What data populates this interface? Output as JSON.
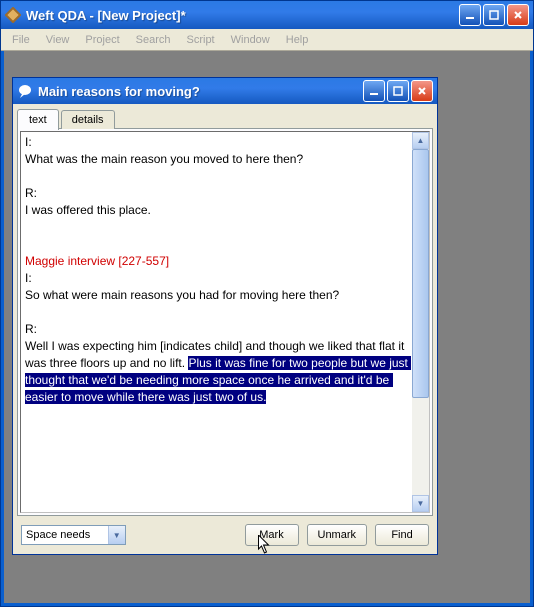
{
  "outer": {
    "title": "Weft QDA - [New Project]*",
    "menu": [
      "File",
      "View",
      "Project",
      "Search",
      "Script",
      "Window",
      "Help"
    ]
  },
  "child": {
    "title": "Main reasons for moving?",
    "tabs": [
      {
        "label": "text",
        "active": true
      },
      {
        "label": "details",
        "active": false
      }
    ],
    "text": {
      "line1": "I:",
      "line2": "What was the main reason you moved to here then?",
      "line3": "",
      "line4": "R:",
      "line5": "I was offered this place.",
      "line6": "",
      "line7": "",
      "ref": "Maggie interview [227-557]",
      "line8": "I:",
      "line9": "So what were main reasons you had for moving here then?",
      "line10": "",
      "line11": "R:",
      "body_pre": "Well I was expecting him [indicates child] and though we liked that flat it was three floors up and no lift. ",
      "body_sel": "Plus it was fine for two people but we just thought that we'd be needing more space once he arrived and it'd be easier to move while there was just two of us."
    },
    "combo": {
      "value": "Space needs"
    },
    "buttons": {
      "mark": "Mark",
      "unmark": "Unmark",
      "find": "Find"
    }
  }
}
